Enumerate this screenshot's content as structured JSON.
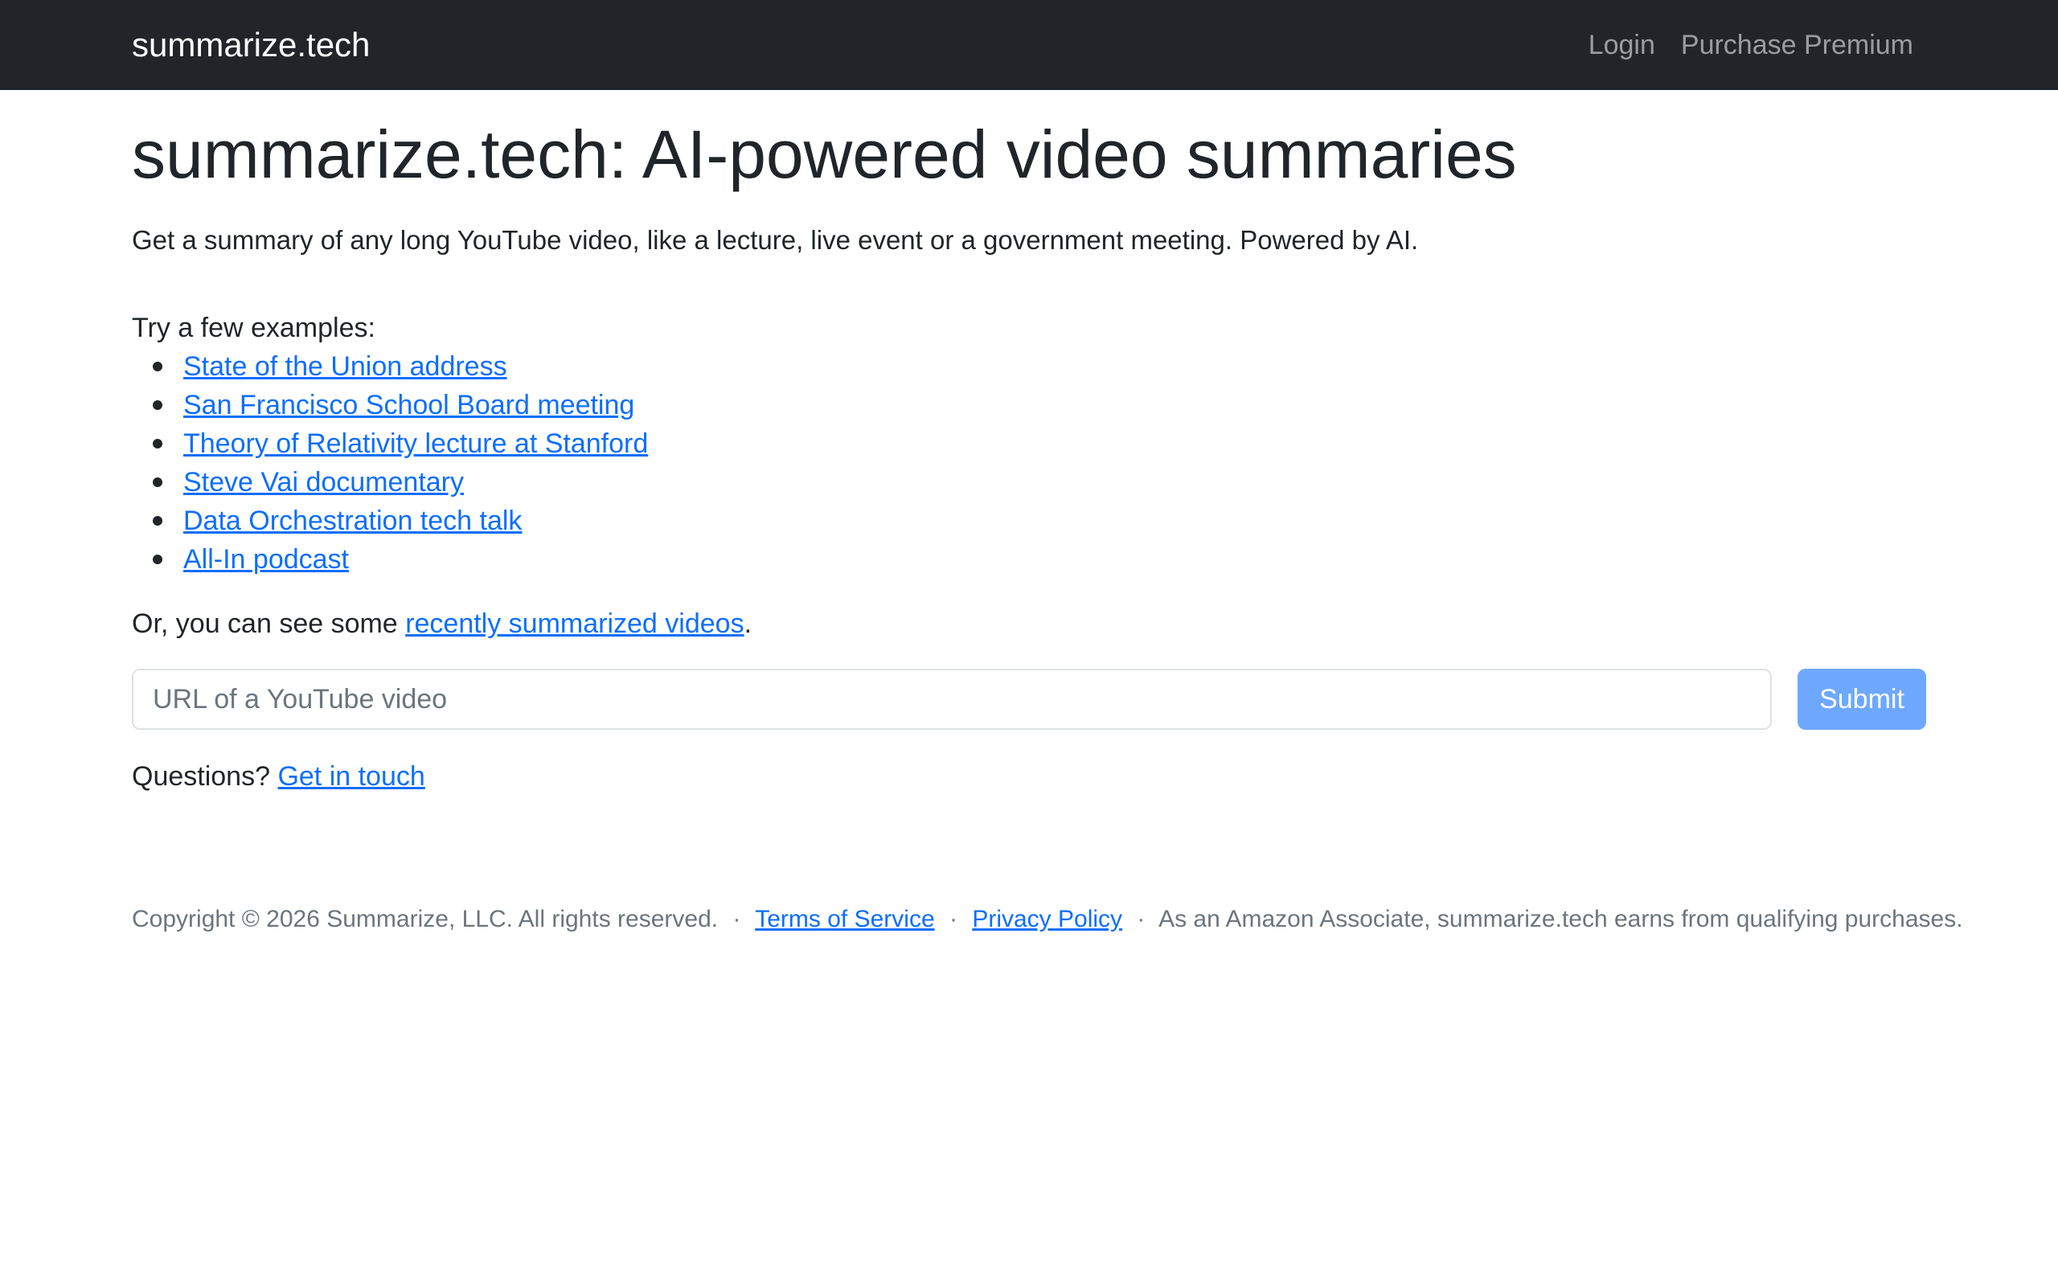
{
  "navbar": {
    "brand": "summarize.tech",
    "links": [
      "Login",
      "Purchase Premium"
    ]
  },
  "main": {
    "title": "summarize.tech: AI-powered video summaries",
    "lead": "Get a summary of any long YouTube video, like a lecture, live event or a government meeting. Powered by AI.",
    "examples_intro": "Try a few examples:",
    "examples": [
      "State of the Union address",
      "San Francisco School Board meeting",
      "Theory of Relativity lecture at Stanford",
      "Steve Vai documentary",
      "Data Orchestration tech talk",
      "All-In podcast"
    ],
    "recent_prefix": "Or, you can see some",
    "recent_link": "recently summarized videos",
    "recent_suffix": ".",
    "url_placeholder": "URL of a YouTube video",
    "submit_label": "Submit",
    "questions_prefix": "Questions?",
    "questions_link": "Get in touch"
  },
  "footer": {
    "copyright": "Copyright © 2026 Summarize, LLC. All rights reserved.",
    "separator": "·",
    "terms": "Terms of Service",
    "privacy": "Privacy Policy",
    "amazon": "As an Amazon Associate, summarize.tech earns from qualifying purchases."
  },
  "colors": {
    "navbar_bg": "#212529",
    "link": "#0d6efd",
    "submit_bg": "#6ea8fe",
    "muted": "#6c757d"
  }
}
